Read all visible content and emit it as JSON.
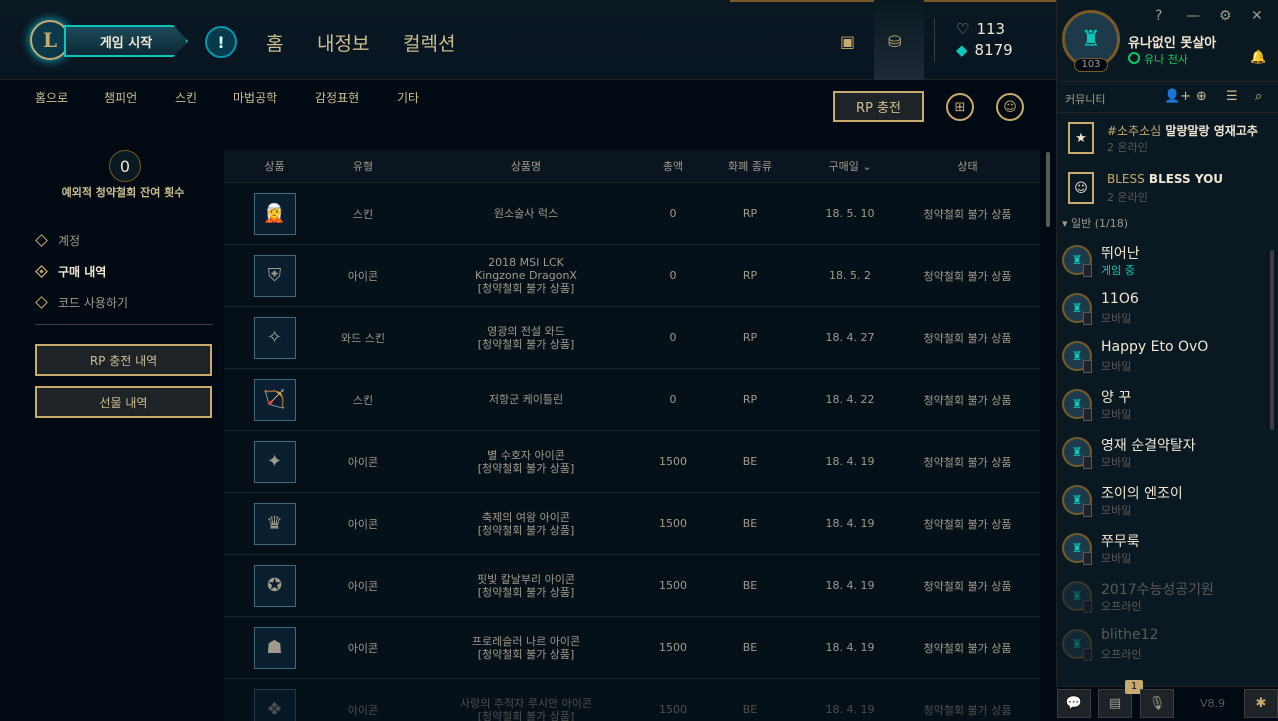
{
  "header": {
    "play_label": "게임 시작",
    "alert_label": "!",
    "nav": [
      "홈",
      "내정보",
      "컬렉션"
    ],
    "currency": {
      "rp": "113",
      "be": "8179"
    }
  },
  "subnav": {
    "items": [
      "홈으로",
      "챔피언",
      "스킨",
      "마법공학",
      "감정표현",
      "기타"
    ],
    "rp_button": "RP 충전"
  },
  "left": {
    "counter": "0",
    "counter_label": "예외적 청약철회 잔여 횟수",
    "menu": [
      "계정",
      "구매 내역",
      "코드 사용하기"
    ],
    "buttons": [
      "RP 충전 내역",
      "선물 내역"
    ]
  },
  "table": {
    "headers": [
      "상품",
      "유형",
      "상품명",
      "총액",
      "화폐 종류",
      "구매일",
      "상태"
    ],
    "rows": [
      {
        "thumb": "🧝",
        "type": "스킨",
        "name": "원소술사 럭스",
        "name2": "",
        "amount": "0",
        "currency": "RP",
        "date": "18. 5. 10",
        "status": "청약철회 불가 상품"
      },
      {
        "thumb": "⛨",
        "type": "아이콘",
        "name": "2018 MSI LCK",
        "name2": "Kingzone DragonX",
        "name3": "[청약철회 불가 상품]",
        "amount": "0",
        "currency": "RP",
        "date": "18. 5. 2",
        "status": "청약철회 불가 상품"
      },
      {
        "thumb": "✧",
        "type": "와드 스킨",
        "name": "영광의 전설 와드",
        "name2": "[청약철회 불가 상품]",
        "amount": "0",
        "currency": "RP",
        "date": "18. 4. 27",
        "status": "청약철회 불가 상품"
      },
      {
        "thumb": "🏹",
        "type": "스킨",
        "name": "저항군 케이틀린",
        "name2": "",
        "amount": "0",
        "currency": "RP",
        "date": "18. 4. 22",
        "status": "청약철회 불가 상품"
      },
      {
        "thumb": "✦",
        "type": "아이콘",
        "name": "별 수호자 아이콘",
        "name2": "[청약철회 불가 상품]",
        "amount": "1500",
        "currency": "BE",
        "date": "18. 4. 19",
        "status": "청약철회 불가 상품"
      },
      {
        "thumb": "♛",
        "type": "아이콘",
        "name": "축제의 여왕 아이콘",
        "name2": "[청약철회 불가 상품]",
        "amount": "1500",
        "currency": "BE",
        "date": "18. 4. 19",
        "status": "청약철회 불가 상품"
      },
      {
        "thumb": "✪",
        "type": "아이콘",
        "name": "핏빛 칼날부리 아이콘",
        "name2": "[청약철회 불가 상품]",
        "amount": "1500",
        "currency": "BE",
        "date": "18. 4. 19",
        "status": "청약철회 불가 상품"
      },
      {
        "thumb": "☗",
        "type": "아이콘",
        "name": "프로레슬러 나르 아이콘",
        "name2": "[청약철회 불가 상품]",
        "amount": "1500",
        "currency": "BE",
        "date": "18. 4. 19",
        "status": "청약철회 불가 상품"
      },
      {
        "thumb": "❖",
        "type": "아이콘",
        "name": "사랑의 추적자 루시안 아이콘",
        "name2": "[청약철회 불가 상품]",
        "amount": "1500",
        "currency": "BE",
        "date": "18. 4. 19",
        "status": "청약철회 불가 상품"
      }
    ]
  },
  "profile": {
    "name": "유나없인 못살아",
    "status": "유나 천사",
    "level": "103"
  },
  "community": {
    "title": "커뮤니티",
    "groups": [
      {
        "tag": "#소추소심",
        "name": "말랑말랑 영재고추",
        "sub": "2 온라인",
        "icon": "★"
      },
      {
        "tag": "BLESS",
        "name": "BLESS YOU",
        "sub": "2 온라인",
        "icon": "☺"
      }
    ],
    "folder": "일반 (1/18)",
    "friends": [
      {
        "name": "뛰어난",
        "status": "게임 중",
        "state": "game"
      },
      {
        "name": "11O6",
        "status": "모바일",
        "state": "mobile"
      },
      {
        "name": "Happy Eto OvO",
        "status": "모바일",
        "state": "mobile"
      },
      {
        "name": "양 꾸",
        "status": "모바일",
        "state": "mobile"
      },
      {
        "name": "영재 순결약탈자",
        "status": "모바일",
        "state": "mobile"
      },
      {
        "name": "조이의 엔조이",
        "status": "모바일",
        "state": "mobile"
      },
      {
        "name": "쭈무룩",
        "status": "모바일",
        "state": "mobile"
      },
      {
        "name": "2017수능성공기원",
        "status": "오프라인",
        "state": "off"
      },
      {
        "name": "blithe12",
        "status": "오프라인",
        "state": "off"
      }
    ]
  },
  "footer": {
    "badge": "1",
    "version": "V8.9"
  }
}
